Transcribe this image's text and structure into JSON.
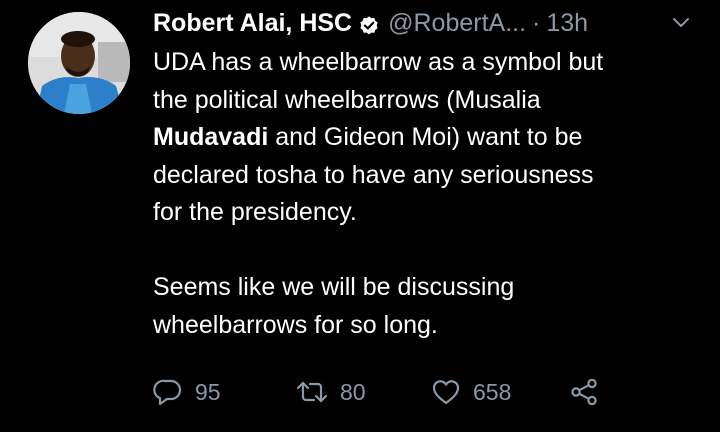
{
  "tweet": {
    "display_name": "Robert Alai, HSC",
    "handle": "@RobertA...",
    "separator": "·",
    "time": "13h",
    "body": {
      "line1": "UDA has a wheelbarrow as a symbol but",
      "line2": "the political wheelbarrows (Musalia",
      "line3_bold": "Mudavadi",
      "line3_rest": " and Gideon Moi) want to be",
      "line4": "declared tosha to have any seriousness",
      "line5": "for the presidency.",
      "line6": "Seems like we will be discussing",
      "line7": "wheelbarrows for so long."
    },
    "actions": {
      "replies": "95",
      "retweets": "80",
      "likes": "658"
    }
  },
  "icons": {
    "verified": "verified-badge-icon",
    "more": "chevron-down-icon",
    "reply": "reply-icon",
    "retweet": "retweet-icon",
    "like": "heart-icon",
    "share": "share-icon"
  },
  "colors": {
    "background": "#000000",
    "text": "#ffffff",
    "muted": "#8b98a5"
  }
}
